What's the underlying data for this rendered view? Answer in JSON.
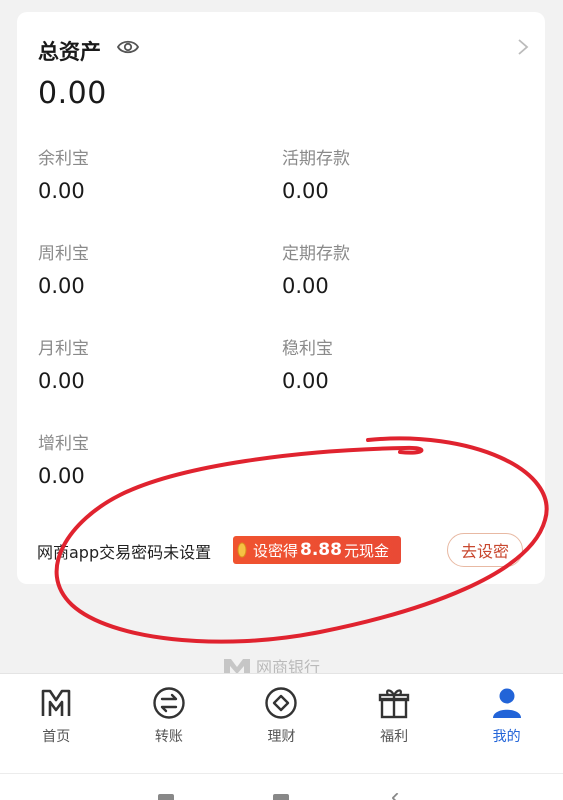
{
  "account": {
    "total_label": "总资产",
    "total_value": "0.00",
    "items": [
      {
        "label": "余利宝",
        "value": "0.00"
      },
      {
        "label": "活期存款",
        "value": "0.00"
      },
      {
        "label": "周利宝",
        "value": "0.00"
      },
      {
        "label": "定期存款",
        "value": "0.00"
      },
      {
        "label": "月利宝",
        "value": "0.00"
      },
      {
        "label": "稳利宝",
        "value": "0.00"
      },
      {
        "label": "增利宝",
        "value": "0.00"
      }
    ]
  },
  "promo": {
    "text": "网商app交易密码未设置",
    "badge_prefix": "设密得",
    "badge_amount": "8.88",
    "badge_suffix": "元现金",
    "button_label": "去设密"
  },
  "brand": {
    "name": "网商银行"
  },
  "tabs": [
    {
      "label": "首页",
      "icon": "home-m-icon"
    },
    {
      "label": "转账",
      "icon": "transfer-icon"
    },
    {
      "label": "理财",
      "icon": "wealth-icon"
    },
    {
      "label": "福利",
      "icon": "gift-icon"
    },
    {
      "label": "我的",
      "icon": "user-icon",
      "active": true
    }
  ],
  "colors": {
    "accent": "#2264d8",
    "promo": "#f0532f",
    "annotation": "#e0232f"
  }
}
